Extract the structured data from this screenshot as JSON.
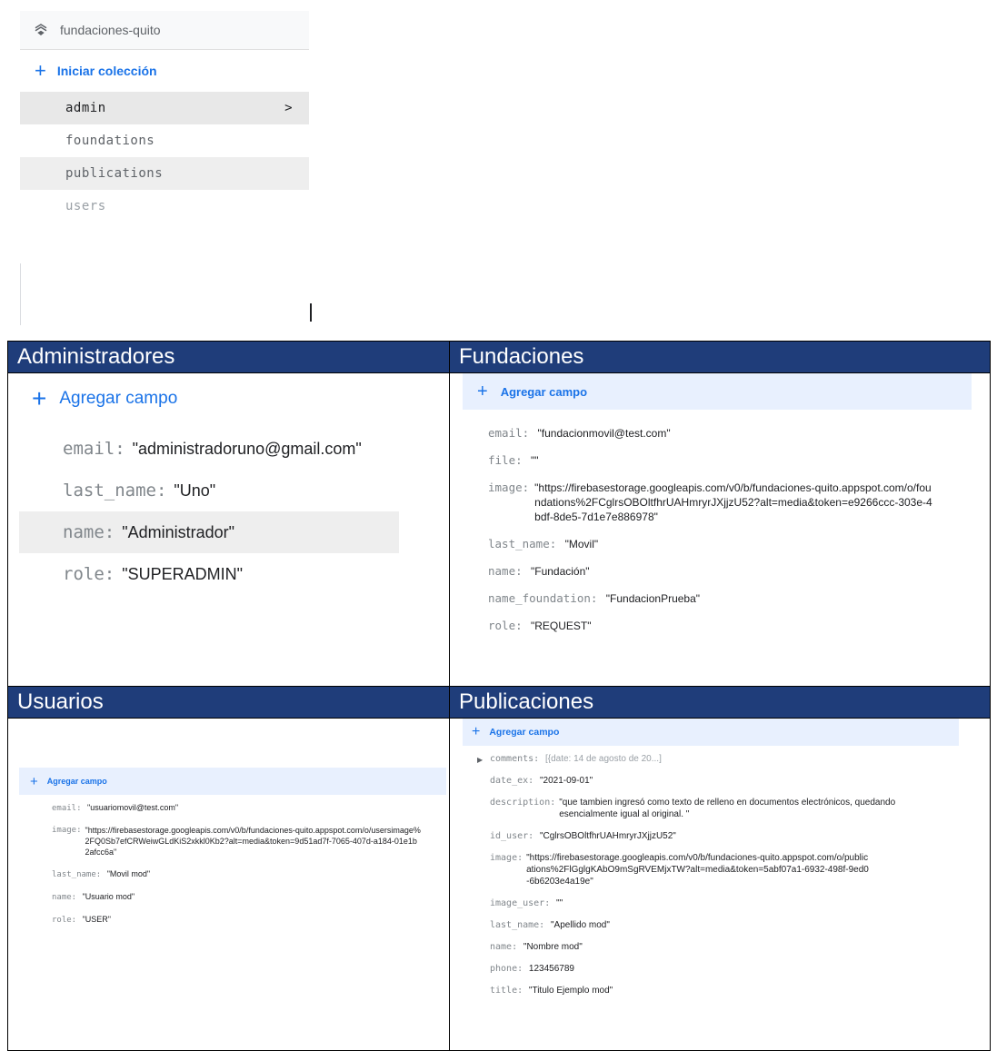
{
  "collections_panel": {
    "database_name": "fundaciones-quito",
    "database_icon": "firestore-icon",
    "start_collection_label": "Iniciar colección",
    "items": [
      {
        "label": "admin"
      },
      {
        "label": "foundations"
      },
      {
        "label": "publications"
      },
      {
        "label": "users"
      }
    ],
    "chevron": ">"
  },
  "panels": {
    "admins": {
      "title": "Administradores",
      "add_field_label": "Agregar campo",
      "fields": [
        {
          "key": "email:",
          "value": "\"administradoruno@gmail.com\""
        },
        {
          "key": "last_name:",
          "value": "\"Uno\""
        },
        {
          "key": "name:",
          "value": "\"Administrador\""
        },
        {
          "key": "role:",
          "value": "\"SUPERADMIN\""
        }
      ]
    },
    "foundations": {
      "title": "Fundaciones",
      "add_field_label": "Agregar campo",
      "fields": [
        {
          "key": "email:",
          "value": "\"fundacionmovil@test.com\""
        },
        {
          "key": "file:",
          "value": "\"\""
        },
        {
          "key": "image:",
          "value": "\"https://firebasestorage.googleapis.com/v0/b/fundaciones-quito.appspot.com/o/foundations%2FCglrsOBOltfhrUAHmryrJXjjzU52?alt=media&token=e9266ccc-303e-4bdf-8de5-7d1e7e886978\""
        },
        {
          "key": "last_name:",
          "value": "\"Movil\""
        },
        {
          "key": "name:",
          "value": "\"Fundación\""
        },
        {
          "key": "name_foundation:",
          "value": "\"FundacionPrueba\""
        },
        {
          "key": "role:",
          "value": "\"REQUEST\""
        }
      ]
    },
    "users": {
      "title": "Usuarios",
      "add_field_label": "Agregar campo",
      "fields": [
        {
          "key": "email:",
          "value": "\"usuariomovil@test.com\""
        },
        {
          "key": "image:",
          "value": "\"https://firebasestorage.googleapis.com/v0/b/fundaciones-quito.appspot.com/o/usersimage%2FQ0Sb7efCRWeiwGLdKiS2xkkl0Kb2?alt=media&token=9d51ad7f-7065-407d-a184-01e1b2afcc6a\""
        },
        {
          "key": "last_name:",
          "value": "\"Movil mod\""
        },
        {
          "key": "name:",
          "value": "\"Usuario mod\""
        },
        {
          "key": "role:",
          "value": "\"USER\""
        }
      ]
    },
    "publications": {
      "title": "Publicaciones",
      "add_field_label": "Agregar campo",
      "comments": {
        "key": "comments:",
        "value": "[{date: 14 de agosto de 20...]"
      },
      "fields": [
        {
          "key": "date_ex:",
          "value": "\"2021-09-01\""
        },
        {
          "key": "description:",
          "value": "\"que tambien ingresó como texto de relleno en documentos electrónicos, quedando esencialmente igual al original. \""
        },
        {
          "key": "id_user:",
          "value": "\"CglrsOBOltfhrUAHmryrJXjjzU52\""
        },
        {
          "key": "image:",
          "value": "\"https://firebasestorage.googleapis.com/v0/b/fundaciones-quito.appspot.com/o/publications%2FlGglgKAbO9mSgRVEMjxTW?alt=media&token=5abf07a1-6932-498f-9ed0-6b6203e4a19e\""
        },
        {
          "key": "image_user:",
          "value": "\"\""
        },
        {
          "key": "last_name:",
          "value": "\"Apellido mod\""
        },
        {
          "key": "name:",
          "value": "\"Nombre mod\""
        },
        {
          "key": "phone:",
          "value": "123456789"
        },
        {
          "key": "title:",
          "value": "\"Titulo Ejemplo mod\""
        }
      ]
    }
  }
}
